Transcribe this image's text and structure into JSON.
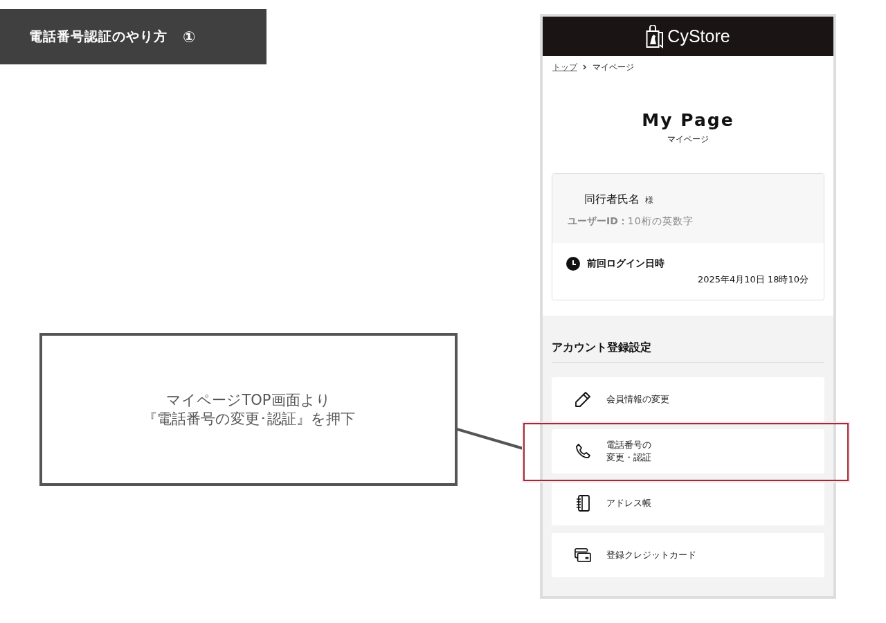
{
  "banner": {
    "title": "電話番号認証のやり方",
    "step": "①"
  },
  "callout": {
    "lines": [
      "マイページTOP画面より",
      "『電話番号の変更･認証』を押下"
    ]
  },
  "phone_screen": {
    "brand": "CyStore",
    "breadcrumb": [
      {
        "label": "トップ",
        "link": true
      },
      {
        "label": "マイページ",
        "link": false
      }
    ],
    "page_title": "My Page",
    "page_subtitle": "マイページ",
    "profile": {
      "name": "同行者氏名",
      "honorific": "様",
      "user_id_label": "ユーザーID：",
      "user_id": "10桁の英数字",
      "last_login_label": "前回ログイン日時",
      "last_login": "2025年4月10日 18時10分"
    },
    "section_title": "アカウント登録設定",
    "menu_items": [
      {
        "label": "会員情報の変更",
        "highlighted": false
      },
      {
        "label_lines": [
          "電話番号の",
          "変更・認証"
        ],
        "highlighted": true
      },
      {
        "label": "アドレス帳",
        "highlighted": false
      },
      {
        "label": "登録クレジットカード",
        "highlighted": false
      }
    ]
  }
}
